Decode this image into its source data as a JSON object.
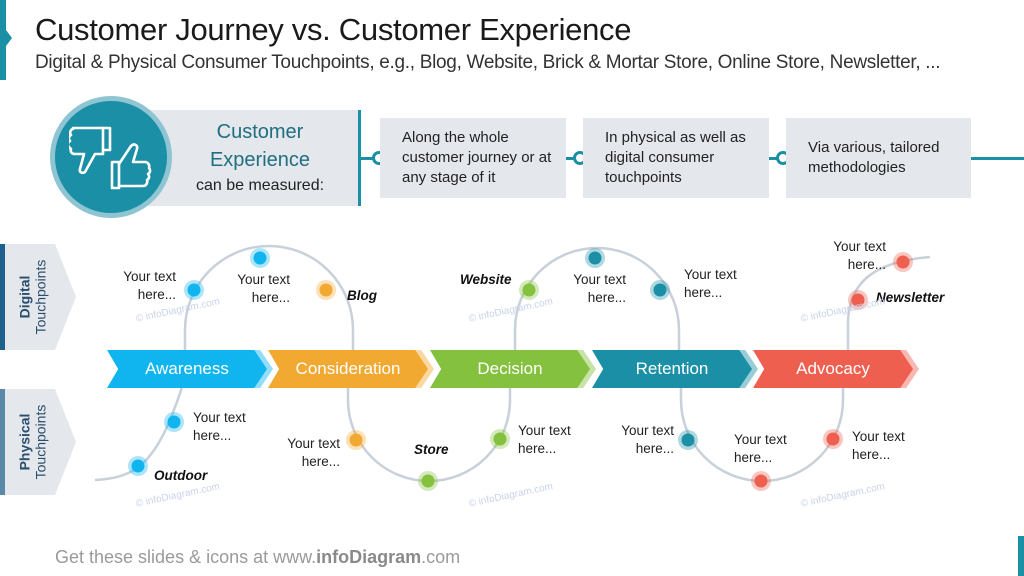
{
  "header": {
    "title": "Customer Journey vs. Customer Experience",
    "subtitle": "Digital & Physical Consumer Touchpoints, e.g., Blog, Website, Brick & Mortar Store, Online Store, Newsletter, ..."
  },
  "cx": {
    "icon": "thumbs-down-thumbs-up-icon",
    "line1": "Customer",
    "line2": "Experience",
    "line3": "can be measured:",
    "features": [
      "Along the whole customer journey or at any stage of it",
      "In physical as well as digital consumer touchpoints",
      "Via various, tailored methodologies"
    ]
  },
  "side_tabs": {
    "digital": {
      "line1": "Digital",
      "line2": "Touchpoints"
    },
    "physical": {
      "line1": "Physical",
      "line2": "Touchpoints"
    }
  },
  "stages": [
    {
      "label": "Awareness",
      "color": "#10b4ef"
    },
    {
      "label": "Consideration",
      "color": "#f2a931"
    },
    {
      "label": "Decision",
      "color": "#83c13f"
    },
    {
      "label": "Retention",
      "color": "#1b8fa6"
    },
    {
      "label": "Advocacy",
      "color": "#ef5f50"
    }
  ],
  "touchpoints": {
    "digital": [
      {
        "stage": "Awareness",
        "text": "Your text here...",
        "emphasis": false
      },
      {
        "stage": "Awareness",
        "text": "Your text here...",
        "emphasis": false
      },
      {
        "stage": "Consideration",
        "text": "Blog",
        "emphasis": true
      },
      {
        "stage": "Decision",
        "text": "Website",
        "emphasis": true
      },
      {
        "stage": "Retention",
        "text": "Your text here...",
        "emphasis": false
      },
      {
        "stage": "Retention",
        "text": "Your text here...",
        "emphasis": false
      },
      {
        "stage": "Advocacy",
        "text": "Newsletter",
        "emphasis": true
      },
      {
        "stage": "Advocacy",
        "text": "Your text here...",
        "emphasis": false
      }
    ],
    "physical": [
      {
        "stage": "Awareness",
        "text": "Outdoor",
        "emphasis": true
      },
      {
        "stage": "Awareness",
        "text": "Your text here...",
        "emphasis": false
      },
      {
        "stage": "Consideration",
        "text": "Your text here...",
        "emphasis": false
      },
      {
        "stage": "Decision",
        "text": "Store",
        "emphasis": true
      },
      {
        "stage": "Decision",
        "text": "Your text here...",
        "emphasis": false
      },
      {
        "stage": "Retention",
        "text": "Your text here...",
        "emphasis": false
      },
      {
        "stage": "Advocacy",
        "text": "Your text here...",
        "emphasis": false
      },
      {
        "stage": "Advocacy",
        "text": "Your text here...",
        "emphasis": false
      }
    ]
  },
  "watermark": "© infoDiagram.com",
  "footer": {
    "prefix": "Get these slides & icons at www.",
    "brand": "infoDiagram",
    "suffix": ".com"
  },
  "colors": {
    "accent": "#1b8fa6",
    "panel": "#e4e7ec",
    "curve": "#c8d0da"
  }
}
